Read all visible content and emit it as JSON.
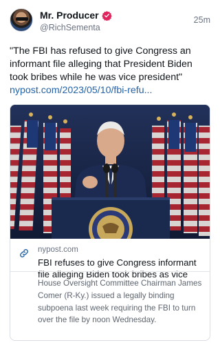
{
  "post": {
    "author": {
      "display_name": "Mr. Producer",
      "handle": "@RichSementa",
      "avatar_icon": "avatar-photo",
      "verified_icon": "verified-badge-icon",
      "verified_color": "#e0245e"
    },
    "timestamp": "25m",
    "text": "\"The FBI has refused to give Congress an informant file alleging that President Biden took bribes while he was vice president\"",
    "link_text": "nypost.com/2023/05/10/fbi-refu..."
  },
  "card": {
    "image_icon": "podium-flags-photo",
    "link_icon": "link-icon",
    "domain": "nypost.com",
    "title": "FBI refuses to give Congress informant file alleging Biden took bribes as vice",
    "description": "House Oversight Committee Chairman James Comer (R-Ky.) issued a legally binding subpoena last week requiring the FBI to turn over the file by noon Wednesday."
  },
  "colors": {
    "link": "#2563a8",
    "muted_text": "#6b7280",
    "card_border": "#d9dde3"
  }
}
